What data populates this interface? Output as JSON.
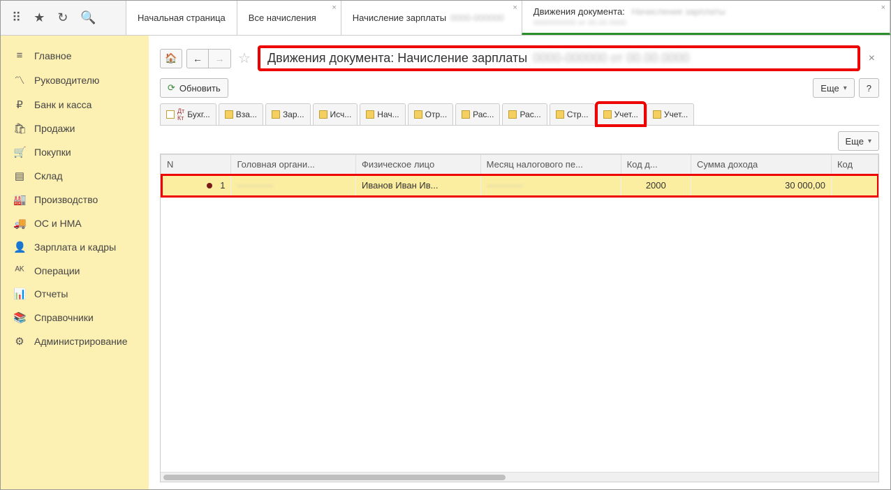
{
  "topbar": {
    "tabs": [
      {
        "label": "Начальная страница",
        "closable": false
      },
      {
        "label": "Все начисления",
        "closable": true
      },
      {
        "label": "Начисление зарплаты",
        "extra_blur": true,
        "closable": true
      },
      {
        "label": "Движения документа:",
        "extra_blur2": true,
        "closable": true,
        "active": true
      }
    ]
  },
  "sidebar": {
    "items": [
      {
        "icon": "≡",
        "label": "Главное"
      },
      {
        "icon": "〽",
        "label": "Руководителю"
      },
      {
        "icon": "₽",
        "label": "Банк и касса"
      },
      {
        "icon": "🛍",
        "label": "Продажи"
      },
      {
        "icon": "🛒",
        "label": "Покупки"
      },
      {
        "icon": "▤",
        "label": "Склад"
      },
      {
        "icon": "🏭",
        "label": "Производство"
      },
      {
        "icon": "🚚",
        "label": "ОС и НМА"
      },
      {
        "icon": "👤",
        "label": "Зарплата и кадры"
      },
      {
        "icon": "ᴬᴷ",
        "label": "Операции"
      },
      {
        "icon": "📊",
        "label": "Отчеты"
      },
      {
        "icon": "📚",
        "label": "Справочники"
      },
      {
        "icon": "⚙",
        "label": "Администрирование"
      }
    ]
  },
  "header": {
    "title": "Движения документа: Начисление зарплаты",
    "refresh": "Обновить",
    "more": "Еще",
    "help": "?"
  },
  "reg_tabs": [
    {
      "label": "Бухг...",
      "icon": "r"
    },
    {
      "label": "Вза..."
    },
    {
      "label": "Зар..."
    },
    {
      "label": "Исч..."
    },
    {
      "label": "Нач..."
    },
    {
      "label": "Отр..."
    },
    {
      "label": "Рас..."
    },
    {
      "label": "Рас..."
    },
    {
      "label": "Стр..."
    },
    {
      "label": "Учет...",
      "hl": true
    },
    {
      "label": "Учет..."
    }
  ],
  "table": {
    "more": "Еще",
    "columns": [
      "N",
      "Головная органи...",
      "Физическое лицо",
      "Месяц налогового пе...",
      "Код д...",
      "Сумма дохода",
      "Код"
    ],
    "rows": [
      {
        "n": "1",
        "org_blur": "————",
        "person": "Иванов Иван Ив...",
        "month_blur": "————",
        "code": "2000",
        "sum": "30 000,00"
      }
    ]
  }
}
